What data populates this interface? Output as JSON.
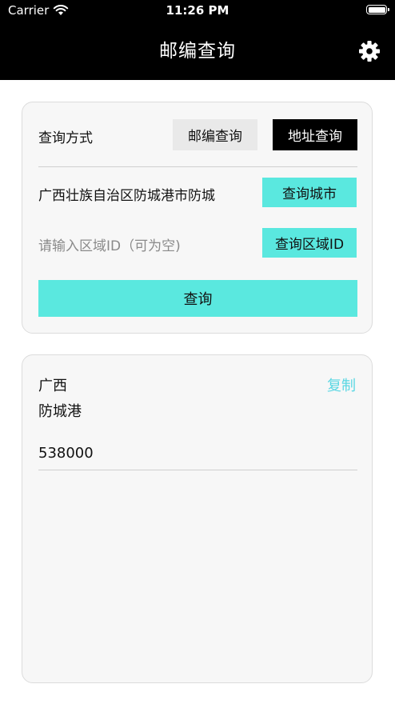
{
  "status_bar": {
    "carrier": "Carrier",
    "time": "11:26 PM"
  },
  "nav": {
    "title": "邮编查询",
    "settings_icon": "gear-icon"
  },
  "query_card": {
    "mode_label": "查询方式",
    "mode_options": [
      "邮编查询",
      "地址查询"
    ],
    "selected_mode": "地址查询",
    "city_input_value": "广西壮族自治区防城港市防城",
    "city_button": "查询城市",
    "region_input_placeholder": "请输入区域ID（可为空)",
    "region_button": "查询区域ID",
    "query_button": "查询"
  },
  "result_card": {
    "province": "广西",
    "city": "防城港",
    "copy_label": "复制",
    "postal_code": "538000"
  },
  "colors": {
    "accent_cyan": "#5ae8df",
    "copy_link": "#5ad7e3",
    "header_bg": "#000000",
    "selected_mode_bg": "#000000"
  }
}
